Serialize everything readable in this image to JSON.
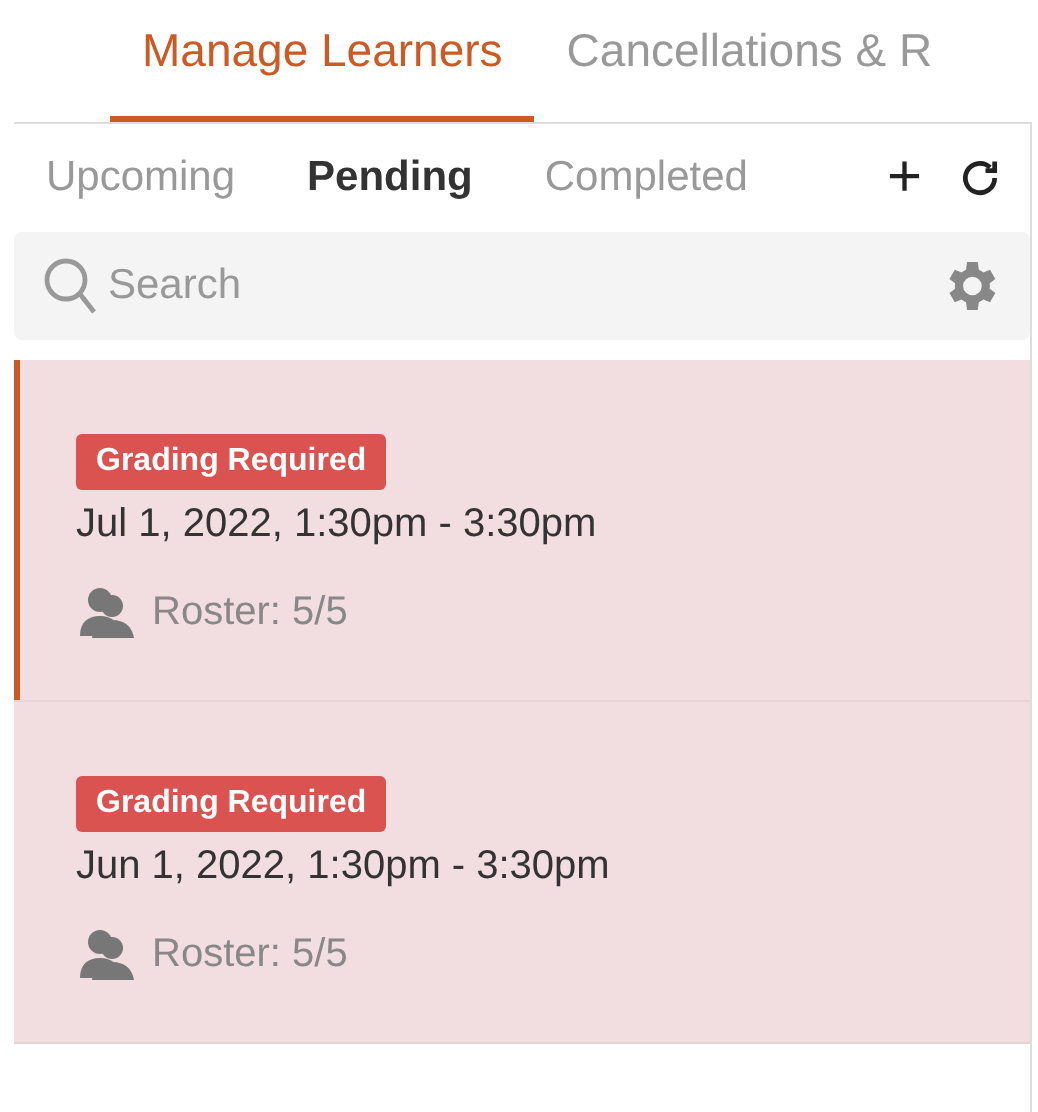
{
  "top_tabs": [
    {
      "label": "Manage Learners",
      "selected": true
    },
    {
      "label": "Cancellations & R",
      "selected": false
    }
  ],
  "sub_tabs": [
    {
      "label": "Upcoming",
      "selected": false
    },
    {
      "label": "Pending",
      "selected": true
    },
    {
      "label": "Completed",
      "selected": false
    }
  ],
  "toolbar": {
    "add": "+"
  },
  "search": {
    "placeholder": "Search"
  },
  "sessions": [
    {
      "badge": "Grading Required",
      "date": "Jul 1, 2022, 1:30pm - 3:30pm",
      "roster": "Roster: 5/5",
      "selected": true
    },
    {
      "badge": "Grading Required",
      "date": "Jun 1, 2022, 1:30pm - 3:30pm",
      "roster": "Roster: 5/5",
      "selected": false
    }
  ]
}
